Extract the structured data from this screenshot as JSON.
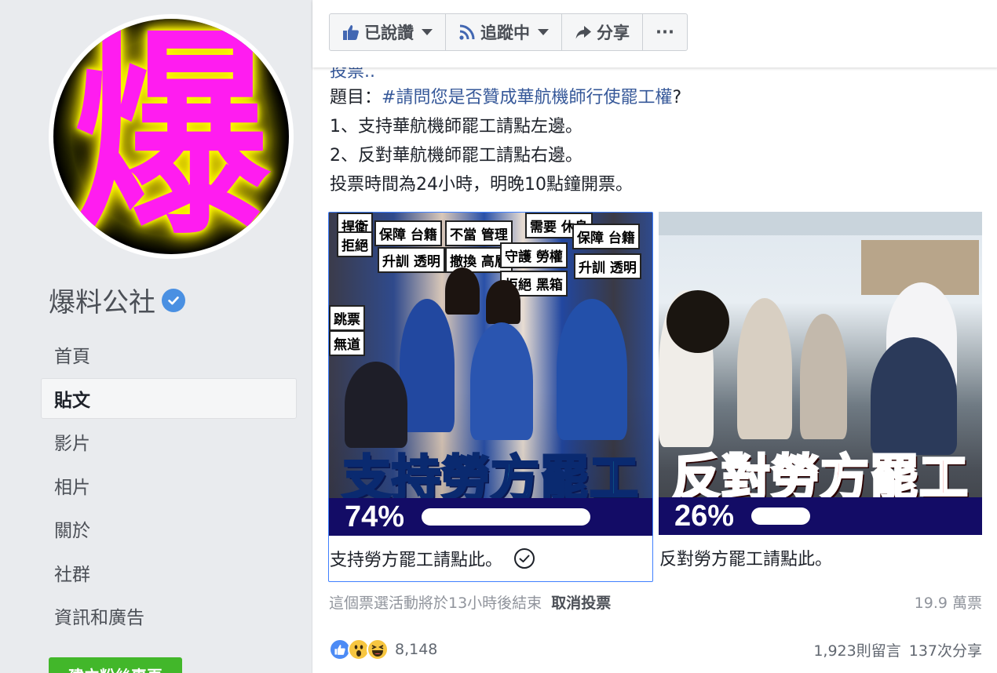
{
  "page": {
    "avatar_char": "爆",
    "name": "爆料公社"
  },
  "nav": {
    "items": [
      {
        "label": "首頁"
      },
      {
        "label": "貼文"
      },
      {
        "label": "影片"
      },
      {
        "label": "相片"
      },
      {
        "label": "關於"
      },
      {
        "label": "社群"
      },
      {
        "label": "資訊和廣告"
      }
    ],
    "active_index": 1,
    "create_button": "建立粉絲專頁"
  },
  "toolbar": {
    "liked": "已說讚",
    "following": "追蹤中",
    "share": "分享",
    "more": "···"
  },
  "post": {
    "cut_line": "投票..",
    "question_prefix": "題目：",
    "question_hashtag": "#請問您是否贊成華航機師行使罷工權",
    "question_suffix": "?",
    "line1": "1、支持華航機師罷工請點左邊。",
    "line2": "2、反對華航機師罷工請點右邊。",
    "line3": "投票時間為24小時，明晚10點鐘開票。"
  },
  "poll": {
    "options": [
      {
        "banner": "支持勞方罷工",
        "percent": "74%",
        "fraction": 0.74,
        "label": "支持勞方罷工請點此。",
        "selected": true,
        "signs": [
          "捍衛",
          "拒絕",
          "保障 台籍",
          "不當 管理",
          "需要 休息",
          "保障 台籍",
          "升訓 透明",
          "撤換 高層",
          "守護 勞權",
          "升訓 透明",
          "拒絕 黑箱",
          "跳票",
          "無道"
        ]
      },
      {
        "banner": "反對勞方罷工",
        "percent": "26%",
        "fraction": 0.26,
        "label": "反對勞方罷工請點此。",
        "selected": false
      }
    ],
    "footer_status": "這個票選活動將於13小時後結束",
    "cancel_vote": "取消投票",
    "views": "19.9 萬票"
  },
  "engagement": {
    "reaction_count": "8,148",
    "comments": "1,923則留言",
    "shares": "137次分享"
  },
  "colors": {
    "accent": "#365899",
    "poll_bar": "#130c66",
    "selected_border": "#4080ff",
    "avatar_glyph": "#ff1cf0",
    "create_button": "#42b72a"
  }
}
